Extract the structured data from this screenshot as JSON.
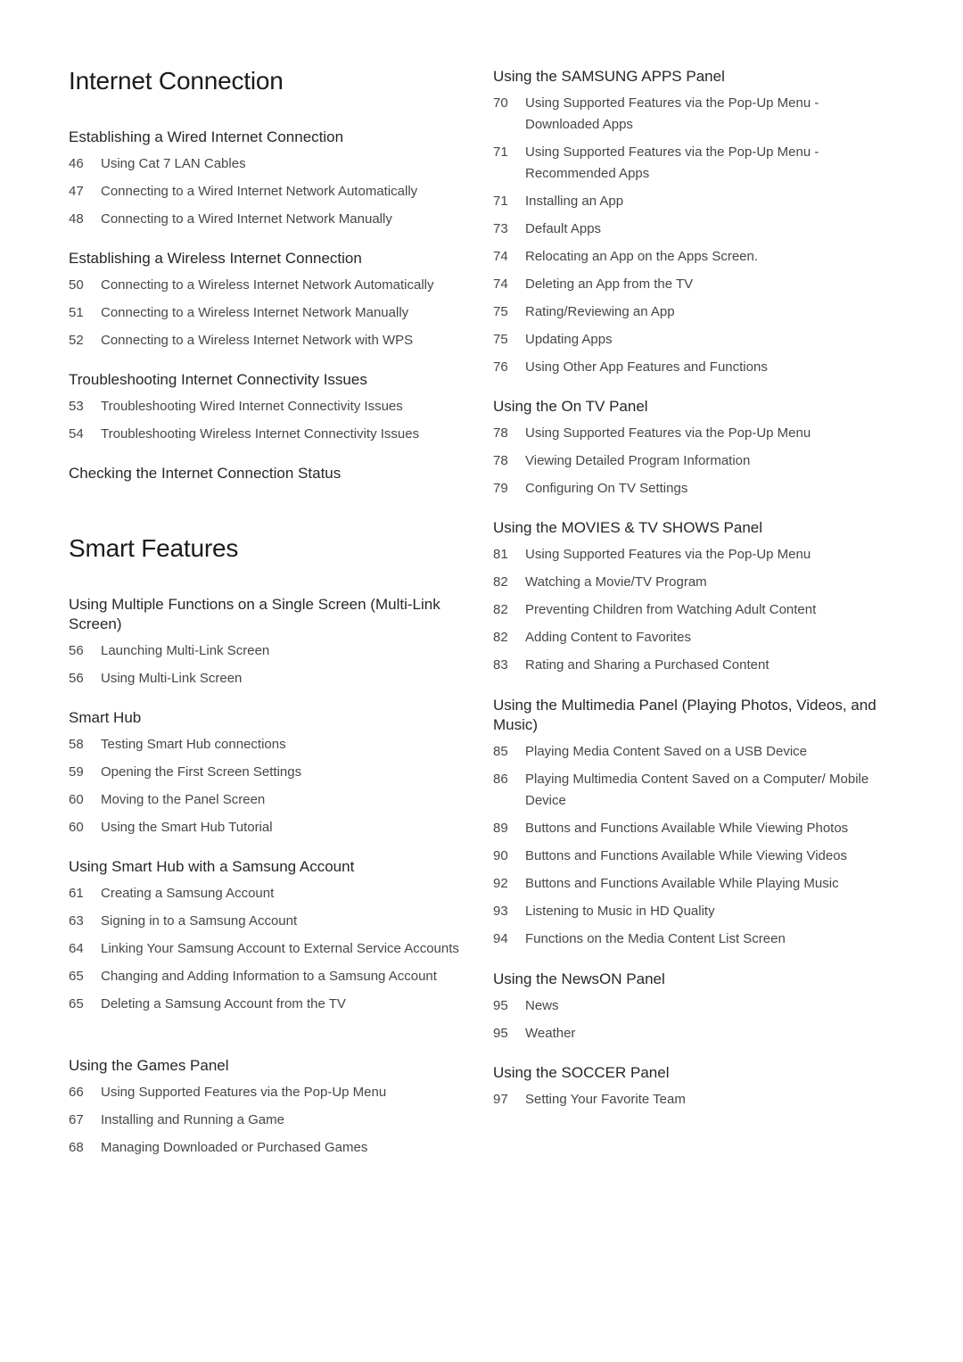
{
  "left": {
    "chapter1": "Internet Connection",
    "chapter2": "Smart Features",
    "sections": [
      {
        "title": "Establishing a Wired Internet Connection",
        "entries": [
          {
            "page": "46",
            "text": "Using Cat 7 LAN Cables"
          },
          {
            "page": "47",
            "text": "Connecting to a Wired Internet Network Automatically"
          },
          {
            "page": "48",
            "text": "Connecting to a Wired Internet Network Manually"
          }
        ]
      },
      {
        "title": "Establishing a Wireless Internet Connection",
        "entries": [
          {
            "page": "50",
            "text": "Connecting to a Wireless Internet Network Automatically"
          },
          {
            "page": "51",
            "text": "Connecting to a Wireless Internet Network Manually"
          },
          {
            "page": "52",
            "text": "Connecting to a Wireless Internet Network with WPS"
          }
        ]
      },
      {
        "title": "Troubleshooting Internet Connectivity Issues",
        "entries": [
          {
            "page": "53",
            "text": "Troubleshooting Wired Internet Connectivity Issues"
          },
          {
            "page": "54",
            "text": "Troubleshooting Wireless Internet Connectivity Issues"
          }
        ]
      },
      {
        "title": "Checking the Internet Connection Status",
        "entries": []
      },
      {
        "title": "Using Multiple Functions on a Single Screen (Multi-Link Screen)",
        "entries": [
          {
            "page": "56",
            "text": "Launching Multi-Link Screen"
          },
          {
            "page": "56",
            "text": "Using Multi-Link Screen"
          }
        ]
      },
      {
        "title": "Smart Hub",
        "entries": [
          {
            "page": "58",
            "text": "Testing Smart Hub connections"
          },
          {
            "page": "59",
            "text": "Opening the First Screen Settings"
          },
          {
            "page": "60",
            "text": "Moving to the Panel Screen"
          },
          {
            "page": "60",
            "text": "Using the Smart Hub Tutorial"
          }
        ]
      },
      {
        "title": "Using Smart Hub with a Samsung Account",
        "entries": [
          {
            "page": "61",
            "text": "Creating a Samsung Account"
          },
          {
            "page": "63",
            "text": "Signing in to a Samsung Account"
          },
          {
            "page": "64",
            "text": "Linking Your Samsung Account to External Service Accounts"
          },
          {
            "page": "65",
            "text": "Changing and Adding Information to a Samsung Account"
          },
          {
            "page": "65",
            "text": "Deleting a Samsung Account from the TV"
          }
        ]
      },
      {
        "title": "Using the Games Panel",
        "entries": [
          {
            "page": "66",
            "text": "Using Supported Features via the Pop-Up Menu"
          },
          {
            "page": "67",
            "text": "Installing and Running a Game"
          },
          {
            "page": "68",
            "text": "Managing Downloaded or Purchased Games"
          }
        ]
      }
    ]
  },
  "right": {
    "sections": [
      {
        "title": "Using the SAMSUNG APPS Panel",
        "entries": [
          {
            "page": "70",
            "text": "Using Supported Features via the Pop-Up Menu - Downloaded Apps"
          },
          {
            "page": "71",
            "text": "Using Supported Features via the Pop-Up Menu - Recommended Apps"
          },
          {
            "page": "71",
            "text": "Installing an App"
          },
          {
            "page": "73",
            "text": "Default Apps"
          },
          {
            "page": "74",
            "text": "Relocating an App on the Apps Screen."
          },
          {
            "page": "74",
            "text": "Deleting an App from the TV"
          },
          {
            "page": "75",
            "text": "Rating/Reviewing an App"
          },
          {
            "page": "75",
            "text": "Updating Apps"
          },
          {
            "page": "76",
            "text": "Using Other App Features and Functions"
          }
        ]
      },
      {
        "title": "Using the On TV Panel",
        "entries": [
          {
            "page": "78",
            "text": "Using Supported Features via the Pop-Up Menu"
          },
          {
            "page": "78",
            "text": "Viewing Detailed Program Information"
          },
          {
            "page": "79",
            "text": "Configuring On TV Settings"
          }
        ]
      },
      {
        "title": "Using the MOVIES & TV SHOWS Panel",
        "entries": [
          {
            "page": "81",
            "text": "Using Supported Features via the Pop-Up Menu"
          },
          {
            "page": "82",
            "text": "Watching a Movie/TV Program"
          },
          {
            "page": "82",
            "text": "Preventing Children from Watching Adult Content"
          },
          {
            "page": "82",
            "text": "Adding Content to Favorites"
          },
          {
            "page": "83",
            "text": "Rating and Sharing a Purchased Content"
          }
        ]
      },
      {
        "title": "Using the Multimedia Panel (Playing Photos, Videos, and Music)",
        "entries": [
          {
            "page": "85",
            "text": "Playing Media Content Saved on a USB Device"
          },
          {
            "page": "86",
            "text": "Playing Multimedia Content Saved on a Computer/ Mobile Device"
          },
          {
            "page": "89",
            "text": "Buttons and Functions Available While Viewing Photos"
          },
          {
            "page": "90",
            "text": "Buttons and Functions Available While Viewing Videos"
          },
          {
            "page": "92",
            "text": "Buttons and Functions Available While Playing Music"
          },
          {
            "page": "93",
            "text": "Listening to Music in HD Quality"
          },
          {
            "page": "94",
            "text": "Functions on the Media Content List Screen"
          }
        ]
      },
      {
        "title": "Using the NewsON Panel",
        "entries": [
          {
            "page": "95",
            "text": "News"
          },
          {
            "page": "95",
            "text": "Weather"
          }
        ]
      },
      {
        "title": "Using the SOCCER Panel",
        "entries": [
          {
            "page": "97",
            "text": "Setting Your Favorite Team"
          }
        ]
      }
    ]
  }
}
